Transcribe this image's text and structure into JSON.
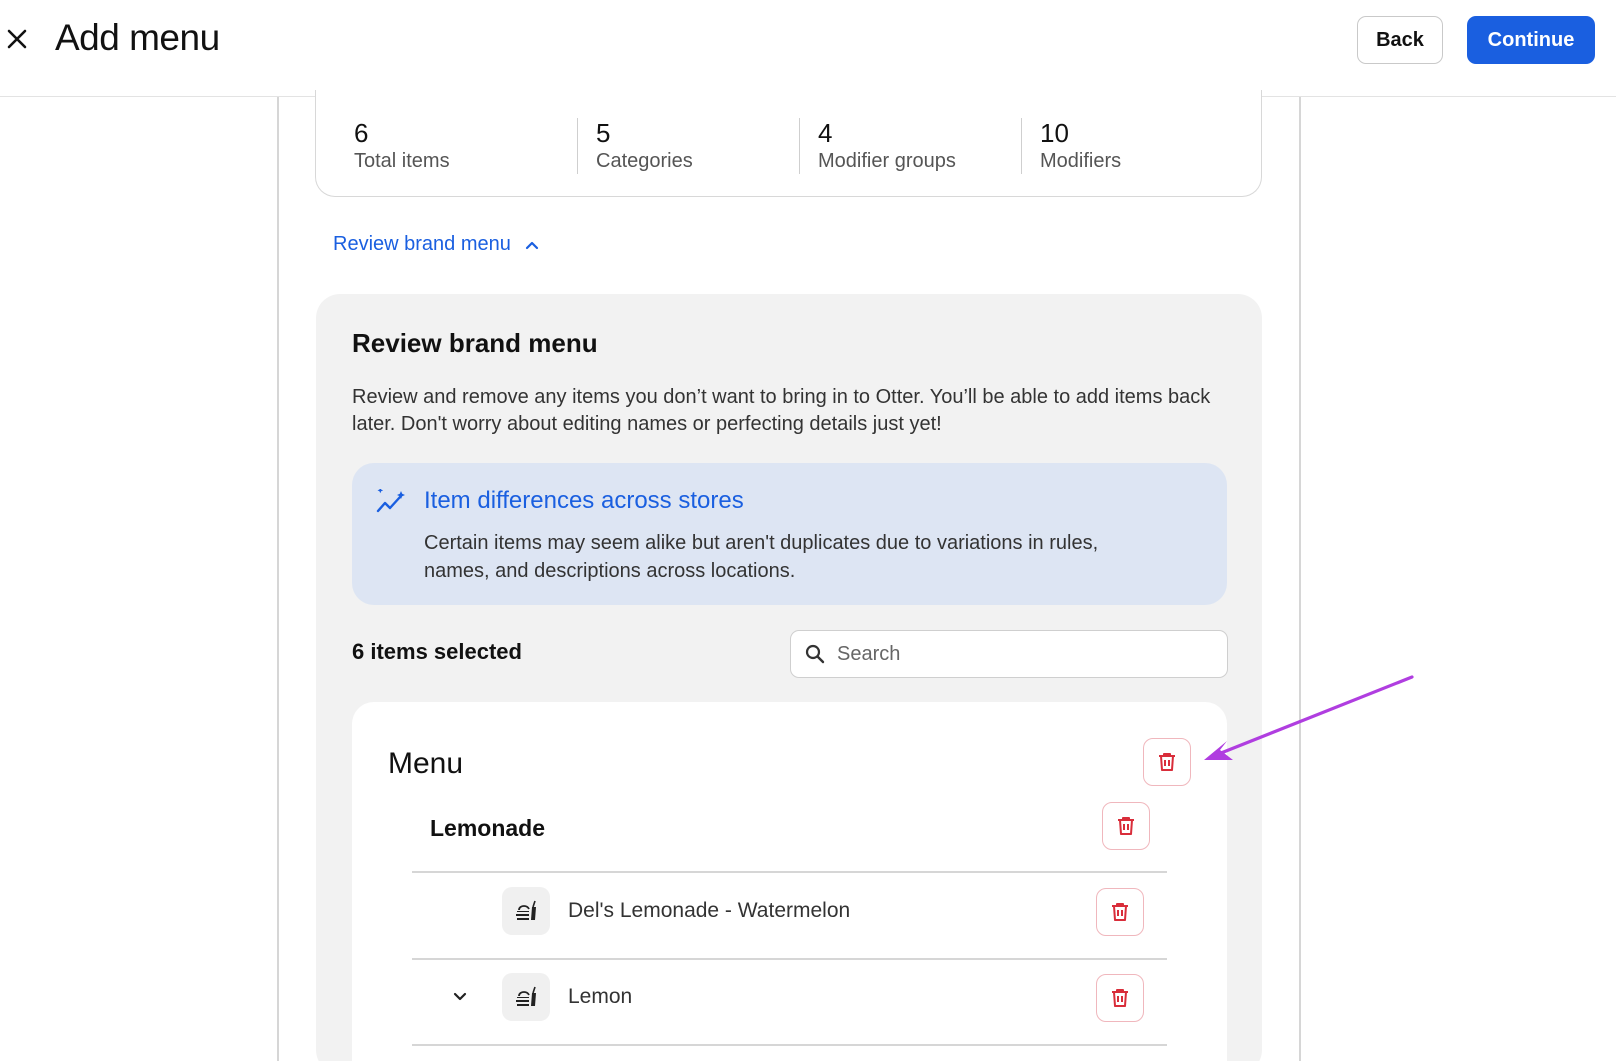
{
  "header": {
    "title": "Add menu",
    "back_label": "Back",
    "continue_label": "Continue",
    "close_icon": "close-icon"
  },
  "stats": [
    {
      "value": "6",
      "label": "Total items"
    },
    {
      "value": "5",
      "label": "Categories"
    },
    {
      "value": "4",
      "label": "Modifier groups"
    },
    {
      "value": "10",
      "label": "Modifiers"
    }
  ],
  "review_toggle": {
    "label": "Review brand menu",
    "icon": "chevron-up-icon"
  },
  "review_panel": {
    "title": "Review brand menu",
    "description": "Review and remove any items you don’t want to bring in to Otter. You’ll be able to add items back later. Don't worry about editing names or perfecting details just yet!",
    "info": {
      "icon": "sparkle-trend-icon",
      "title": "Item differences across stores",
      "text": "Certain items may seem alike but aren't duplicates due to variations in rules, names, and descriptions across locations."
    },
    "selected_count": "6 items selected",
    "search": {
      "placeholder": "Search",
      "value": ""
    }
  },
  "menu": {
    "title": "Menu",
    "category": "Lemonade",
    "items": [
      {
        "name": "Del's Lemonade - Watermelon",
        "has_chevron": false
      },
      {
        "name": "Lemon",
        "has_chevron": true
      }
    ]
  },
  "colors": {
    "accent": "#1a5fe0",
    "danger": "#d92d3a",
    "annotation_arrow": "#b03ee0",
    "info_bg": "#dde5f3",
    "panel_bg": "#f2f2f2"
  }
}
